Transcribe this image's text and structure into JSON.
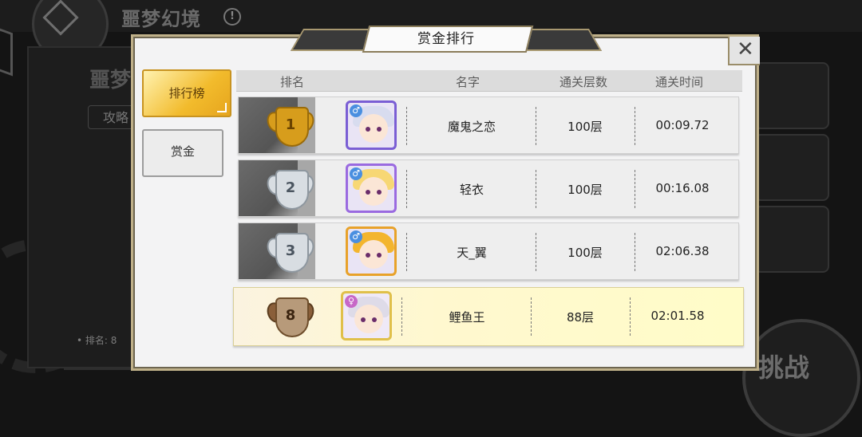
{
  "background": {
    "screen_title": "噩梦幻境",
    "panel_title": "噩梦",
    "strategy_button": "攻略",
    "my_rank_label": "• 排名: 8",
    "challenge_button": "挑战"
  },
  "modal": {
    "title": "赏金排行",
    "close_glyph": "✕",
    "tabs": [
      {
        "label": "排行榜",
        "active": true
      },
      {
        "label": "赏金",
        "active": false
      }
    ],
    "columns": {
      "rank": "排名",
      "name": "名字",
      "floor": "通关层数",
      "time": "通关时间"
    },
    "rows": [
      {
        "rank": "1",
        "medal": "gold",
        "gender": "male",
        "gender_glyph": "♂",
        "name": "魔鬼之恋",
        "floor": "100层",
        "time": "00:09.72"
      },
      {
        "rank": "2",
        "medal": "silver",
        "gender": "male",
        "gender_glyph": "♂",
        "name": "轻衣",
        "floor": "100层",
        "time": "00:16.08"
      },
      {
        "rank": "3",
        "medal": "silver",
        "gender": "male",
        "gender_glyph": "♂",
        "name": "天_翼",
        "floor": "100层",
        "time": "02:06.38"
      },
      {
        "rank": "8",
        "medal": "bronze",
        "gender": "female",
        "gender_glyph": "♀",
        "name": "鲤鱼王",
        "floor": "88层",
        "time": "02:01.58",
        "is_self": true
      }
    ]
  },
  "colors": {
    "active_tab": "#f2bb2c",
    "self_row": "#fff8cf",
    "modal_bg": "#f3f3f4",
    "frame_gold": "#bfb089"
  }
}
